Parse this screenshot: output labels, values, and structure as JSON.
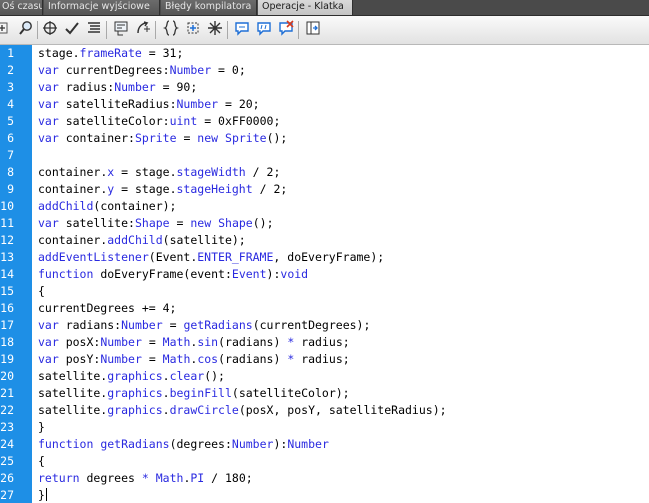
{
  "tabs": [
    {
      "label": "Oś czasu",
      "active": false
    },
    {
      "label": "Informacje wyjściowe",
      "active": false
    },
    {
      "label": "Błędy kompilatora",
      "active": false
    },
    {
      "label": "Operacje - Klatka",
      "active": true
    }
  ],
  "toolbar": {
    "icons": [
      "add-script-icon",
      "find-icon",
      "target-icon",
      "check-syntax-icon",
      "auto-format-icon",
      "code-hint-icon",
      "debug-options-icon",
      "collapse-braces-icon",
      "collapse-selection-icon",
      "expand-all-icon",
      "comment-block-icon",
      "comment-line-icon",
      "uncomment-icon",
      "show-toolbox-icon"
    ]
  },
  "colors": {
    "gutter": "#1e8fe6",
    "keyword": "#2a2ae0",
    "text": "#000000",
    "tab_active": "#c4c4c4",
    "tab_inactive": "#5a5a5a"
  },
  "editor": {
    "lines": [
      {
        "num": "1",
        "code": "stage.frameRate = 31;"
      },
      {
        "num": "2",
        "code": "var currentDegrees:Number = 0;"
      },
      {
        "num": "3",
        "code": "var radius:Number = 90;"
      },
      {
        "num": "4",
        "code": "var satelliteRadius:Number = 20;"
      },
      {
        "num": "5",
        "code": "var satelliteColor:uint = 0xFF0000;"
      },
      {
        "num": "6",
        "code": "var container:Sprite = new Sprite();"
      },
      {
        "num": "7",
        "code": ""
      },
      {
        "num": "8",
        "code": "container.x = stage.stageWidth / 2;"
      },
      {
        "num": "9",
        "code": "container.y = stage.stageHeight / 2;"
      },
      {
        "num": "10",
        "code": "addChild(container);"
      },
      {
        "num": "11",
        "code": "var satellite:Shape = new Shape();"
      },
      {
        "num": "12",
        "code": "container.addChild(satellite);"
      },
      {
        "num": "13",
        "code": "addEventListener(Event.ENTER_FRAME, doEveryFrame);"
      },
      {
        "num": "14",
        "code": "function doEveryFrame(event:Event):void"
      },
      {
        "num": "15",
        "code": "{"
      },
      {
        "num": "16",
        "code": "currentDegrees += 4;"
      },
      {
        "num": "17",
        "code": "var radians:Number = getRadians(currentDegrees);"
      },
      {
        "num": "18",
        "code": "var posX:Number = Math.sin(radians) * radius;"
      },
      {
        "num": "19",
        "code": "var posY:Number = Math.cos(radians) * radius;"
      },
      {
        "num": "20",
        "code": "satellite.graphics.clear();"
      },
      {
        "num": "21",
        "code": "satellite.graphics.beginFill(satelliteColor);"
      },
      {
        "num": "22",
        "code": "satellite.graphics.drawCircle(posX, posY, satelliteRadius);"
      },
      {
        "num": "23",
        "code": "}"
      },
      {
        "num": "24",
        "code": "function getRadians(degrees:Number):Number"
      },
      {
        "num": "25",
        "code": "{"
      },
      {
        "num": "26",
        "code": "return degrees * Math.PI / 180;"
      },
      {
        "num": "27",
        "code": "}"
      }
    ],
    "keywords": [
      ":Number",
      ":uint",
      ":Sprite",
      ":Shape",
      ":Event",
      ":void",
      "frameRate",
      "stageWidth",
      "stageHeight",
      "ENTER_FRAME",
      "addEventListener",
      "addChild",
      "getRadians",
      "beginFill",
      "drawCircle",
      "graphics",
      "function",
      "return",
      "Sprite",
      "Shape",
      "clear",
      "Math",
      "var",
      "new",
      "sin",
      "cos",
      "PI",
      ".x",
      ".y",
      "*"
    ]
  }
}
